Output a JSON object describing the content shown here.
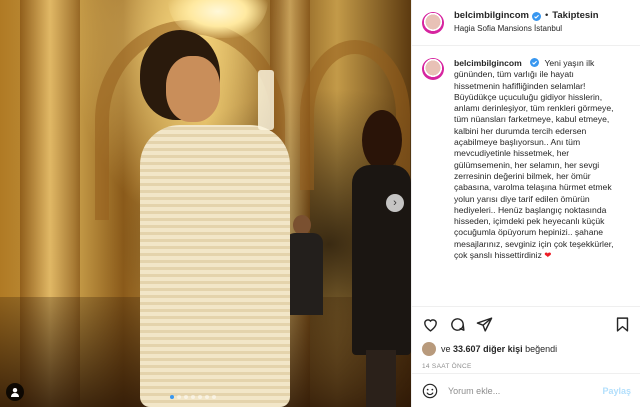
{
  "post": {
    "username": "belcimbilgincom",
    "follow_label": "Takiptesin",
    "separator": "•",
    "location": "Hagia Sofia Mansions İstanbul",
    "caption_text": "Yeni yaşın ilk gününden, tüm varlığı ile hayatı hissetmenin hafifliğinden selamlar! Büyüdükçe uçuculuğu gidiyor hisslerin, anlamı derinleşiyor, tüm renkleri görmeye, tüm nüansları farketmeye, kabul etmeye, kalbini her durumda tercih edersen açabilmeye başlıyorsun.. Anı tüm mevcudiyetinle hissetmek, her gülümsemenin, her selamın, her sevgi zerresinin değerini bilmek, her ömür çabasına, varolma telaşına hürmet etmek yolun yarısı diye tarif edilen ömürün hediyeleri.. Henüz başlangıç noktasında hisseden, içimdeki pek heyecanlı küçük çocuğumla öpüyorum hepinizi.. şahane mesajlarınız, sevginiz için çok teşekkürler, çok şanslı hissettirdiniz",
    "caption_emoji": "❤",
    "likes_count": "33.607",
    "likes_prefix": "ve",
    "likes_suffix": "diğer kişi",
    "likes_tail": "beğendi",
    "timestamp": "14 SAAT ÖNCE",
    "comment_placeholder": "Yorum ekle...",
    "post_button": "Paylaş"
  },
  "colors": {
    "accent": "#3897f0",
    "heart": "#ed1c24",
    "post_button_disabled": "#b2dffc"
  },
  "carousel": {
    "slides": 7,
    "active_index": 0
  },
  "icons": [
    "verified-icon",
    "heart-icon",
    "comment-icon",
    "share-icon",
    "save-icon",
    "emoji-icon",
    "user-tag-icon",
    "next-arrow-icon"
  ]
}
